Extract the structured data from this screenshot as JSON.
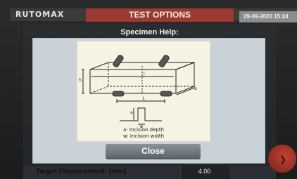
{
  "app": {
    "logo_text": "RUTOMAX"
  },
  "header": {
    "title": "TEST OPTIONS",
    "datetime": "29-09-2020 15:24"
  },
  "dialog": {
    "title": "Specimen Help:",
    "diagram": {
      "label_b": "b",
      "label_h": "h",
      "label_l": "l",
      "label_L": "L",
      "label_a": "a",
      "label_w": "w",
      "legend_a": "a: Incision depth",
      "legend_w": "w: Incision width"
    },
    "close_label": "Close"
  },
  "background_field": {
    "label": "Target Displacement: [mm]",
    "value": "4.00"
  },
  "colors": {
    "title_bar": "#9b3a30",
    "modal_bg": "#c9d2d8",
    "button_top": "#8a9399",
    "button_bottom": "#5b646a",
    "accent_red": "#c04335"
  },
  "icons": {
    "corner_icon": "chevron-icon"
  }
}
